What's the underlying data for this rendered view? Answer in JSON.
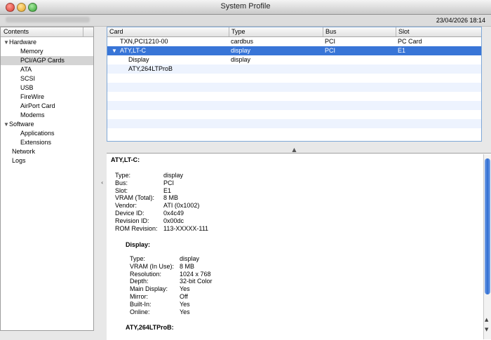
{
  "window": {
    "title": "System Profile",
    "date": "23/04/2026 18:14"
  },
  "sidebar": {
    "header": "Contents",
    "items": [
      {
        "label": "Hardware",
        "level": 0,
        "disclosure": true
      },
      {
        "label": "Memory",
        "level": 1
      },
      {
        "label": "PCI/AGP Cards",
        "level": 1,
        "selected": true
      },
      {
        "label": "ATA",
        "level": 1
      },
      {
        "label": "SCSI",
        "level": 1
      },
      {
        "label": "USB",
        "level": 1
      },
      {
        "label": "FireWire",
        "level": 1
      },
      {
        "label": "AirPort Card",
        "level": 1
      },
      {
        "label": "Modems",
        "level": 1
      },
      {
        "label": "Software",
        "level": 0,
        "disclosure": true
      },
      {
        "label": "Applications",
        "level": 1
      },
      {
        "label": "Extensions",
        "level": 1
      },
      {
        "label": "Network",
        "level": 0
      },
      {
        "label": "Logs",
        "level": 0
      }
    ]
  },
  "table": {
    "columns": [
      "Card",
      "Type",
      "Bus",
      "Slot"
    ],
    "rows": [
      {
        "card": "TXN,PCI1210-00",
        "type": "cardbus",
        "bus": "PCI",
        "slot": "PC Card"
      },
      {
        "card": "ATY,LT-C",
        "type": "display",
        "bus": "PCI",
        "slot": "E1",
        "selected": true
      },
      {
        "card": "Display",
        "type": "display",
        "bus": "",
        "slot": ""
      },
      {
        "card": "ATY,264LTProB",
        "type": "",
        "bus": "",
        "slot": ""
      }
    ]
  },
  "detail": {
    "title": "ATY,LT-C:",
    "fields": [
      {
        "k": "Type:",
        "v": "display"
      },
      {
        "k": "Bus:",
        "v": "PCI"
      },
      {
        "k": "Slot:",
        "v": "E1"
      },
      {
        "k": "VRAM (Total):",
        "v": "8 MB"
      },
      {
        "k": "Vendor:",
        "v": "ATI (0x1002)"
      },
      {
        "k": "Device ID:",
        "v": "0x4c49"
      },
      {
        "k": "Revision ID:",
        "v": "0x00dc"
      },
      {
        "k": "ROM Revision:",
        "v": "113-XXXXX-111"
      }
    ],
    "subsection_title": "Display:",
    "sub_fields": [
      {
        "k": "Type:",
        "v": "display"
      },
      {
        "k": "VRAM (In Use):",
        "v": "8 MB"
      },
      {
        "k": "Resolution:",
        "v": "1024 x 768"
      },
      {
        "k": "Depth:",
        "v": "32-bit Color"
      },
      {
        "k": "Main Display:",
        "v": "Yes"
      },
      {
        "k": "Mirror:",
        "v": "Off"
      },
      {
        "k": "Built-In:",
        "v": "Yes"
      },
      {
        "k": "Online:",
        "v": "Yes"
      }
    ],
    "next_title": "ATY,264LTProB:"
  },
  "colors": {
    "selection": "#3875d7",
    "sidebar_selection": "#d4d4d4",
    "close": "#e3453c",
    "minimize": "#f2b236",
    "zoom": "#3fb83f"
  },
  "icons": {
    "close": "close-button-icon",
    "minimize": "minimize-button-icon",
    "zoom": "zoom-button-icon"
  }
}
